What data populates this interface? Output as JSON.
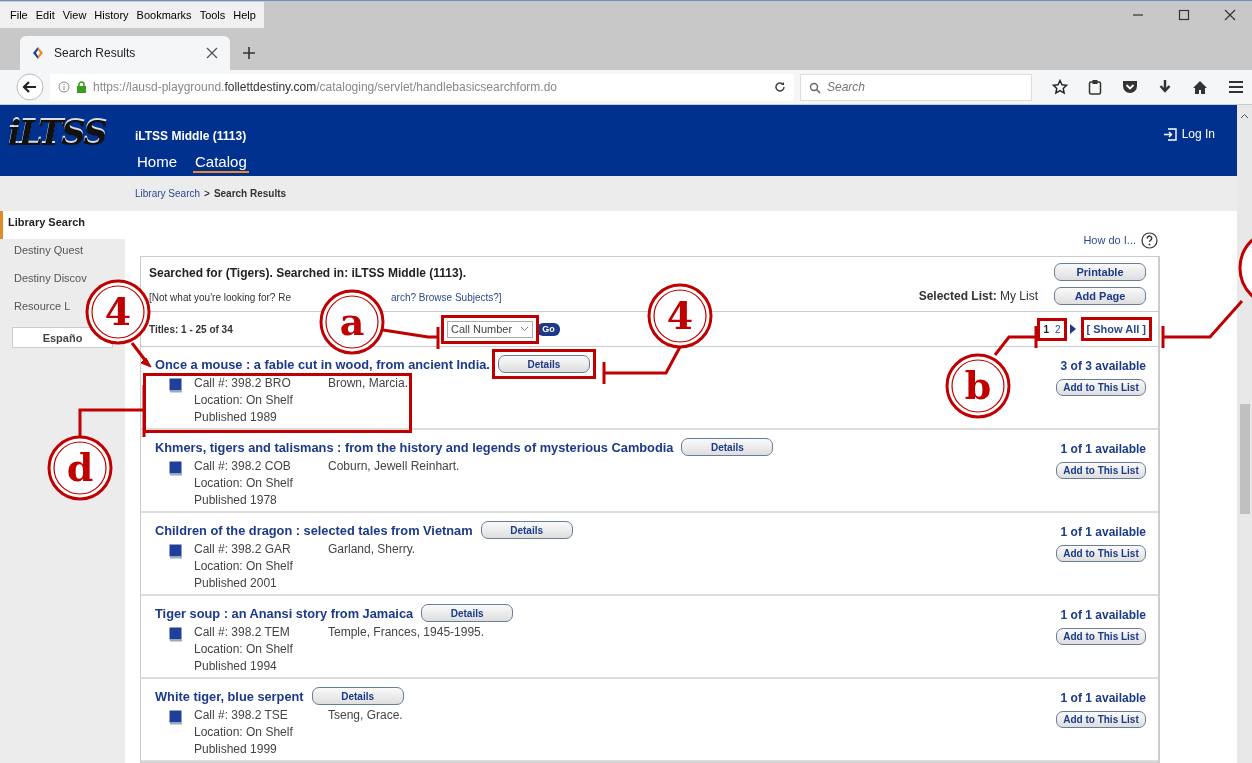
{
  "menu_bar": [
    "File",
    "Edit",
    "View",
    "History",
    "Bookmarks",
    "Tools",
    "Help"
  ],
  "browser_tabs": [
    {
      "title": "Search Results",
      "selected": true
    }
  ],
  "address_bar": {
    "url": "https://lausd-playground.**follettdestiny.com**/cataloging/servlet/handlebasicsearchform.do"
  },
  "search_field": {
    "placeholder": "Search"
  },
  "site_header": {
    "logo": "iLTSS",
    "school": "iLTSS Middle (1113)",
    "login": "Log In"
  },
  "site_nav": [
    {
      "label": "Home",
      "selected": false
    },
    {
      "label": "Catalog",
      "selected": true
    }
  ],
  "breadcrumb": {
    "link": "Library Search",
    "separator": ">",
    "current": "Search Results"
  },
  "sidebar": {
    "items": [
      {
        "label": "Library Search",
        "selected": true
      },
      {
        "label": "Destiny Quest",
        "selected": false
      },
      {
        "label": "Destiny Discov",
        "selected": false
      },
      {
        "label": "Resource L",
        "selected": false
      }
    ],
    "language_button": "Españo"
  },
  "help_link": "How do I...",
  "search_summary": {
    "text": "Searched for (Tigers). Searched in: iLTSS Middle (1113).",
    "hint_start": "[Not what you're looking for? Re",
    "hint_end": "arch? Browse Subjects?]"
  },
  "actions": [
    "Printable",
    "Add Page"
  ],
  "selected_list": {
    "label": "Selected List:",
    "value": "My List"
  },
  "titles_count": "Titles: 1 - 25 of 34",
  "sort": {
    "value": "Call Number",
    "go": "Go"
  },
  "pagination": {
    "pages": [
      {
        "label": "1",
        "selected": true
      },
      {
        "label": "2",
        "selected": false
      }
    ],
    "show_all": "[ Show All ]"
  },
  "results": [
    {
      "title": "Once a mouse : a fable cut in wood, from ancient India.",
      "details": "Details",
      "call": "Call #: 398.2 BRO",
      "author": "Brown, Marcia.",
      "location": "Location: On Shelf",
      "published": "Published 1989",
      "availability": "3 of 3 available",
      "add": "Add to This List"
    },
    {
      "title": "Khmers, tigers and talismans : from the history and legends of mysterious Cambodia",
      "details": "Details",
      "call": "Call #: 398.2 COB",
      "author": "Coburn, Jewell Reinhart.",
      "location": "Location: On Shelf",
      "published": "Published 1978",
      "availability": "1 of 1 available",
      "add": "Add to This List"
    },
    {
      "title": "Children of the dragon : selected tales from Vietnam",
      "details": "Details",
      "call": "Call #: 398.2 GAR",
      "author": "Garland, Sherry.",
      "location": "Location: On Shelf",
      "published": "Published 2001",
      "availability": "1 of 1 available",
      "add": "Add to This List"
    },
    {
      "title": "Tiger soup : an Anansi story from Jamaica",
      "details": "Details",
      "call": "Call #: 398.2 TEM",
      "author": "Temple, Frances, 1945-1995.",
      "location": "Location: On Shelf",
      "published": "Published 1994",
      "availability": "1 of 1 available",
      "add": "Add to This List"
    },
    {
      "title": "White tiger, blue serpent",
      "details": "Details",
      "call": "Call #: 398.2 TSE",
      "author": "Tseng, Grace.",
      "location": "Location: On Shelf",
      "published": "Published 1999",
      "availability": "1 of 1 available",
      "add": "Add to This List"
    }
  ],
  "annotations": [
    {
      "label": "4"
    },
    {
      "label": "a"
    },
    {
      "label": "4"
    },
    {
      "label": "b"
    },
    {
      "label": "d"
    }
  ]
}
